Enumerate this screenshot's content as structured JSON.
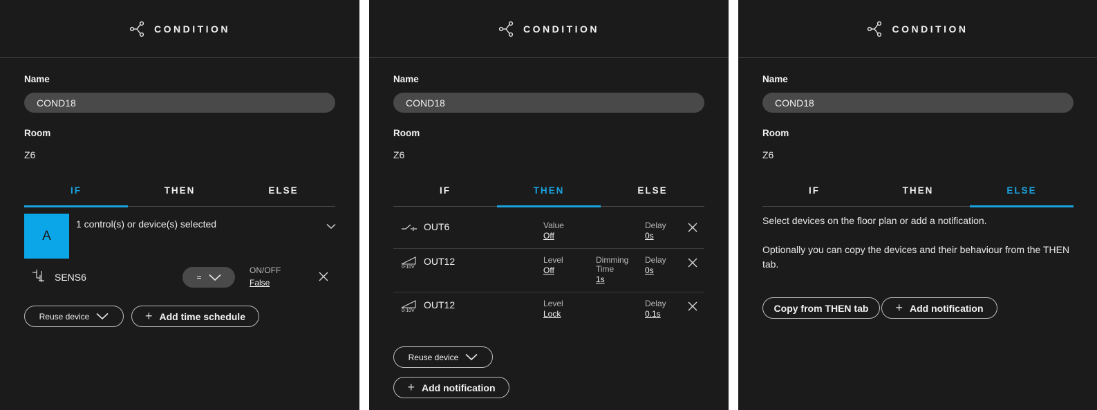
{
  "header": {
    "title": "CONDITION",
    "icon": "branch-icon"
  },
  "form": {
    "name_label": "Name",
    "name_value": "COND18",
    "room_label": "Room",
    "room_value": "Z6"
  },
  "tabs": [
    "IF",
    "THEN",
    "ELSE"
  ],
  "if_panel": {
    "active_tab": "IF",
    "group_letter": "A",
    "group_summary": "1 control(s) or device(s) selected",
    "device_name": "SENS6",
    "operator": "=",
    "param_label": "ON/OFF",
    "param_value": "False",
    "reuse_label": "Reuse device",
    "schedule_label": "Add time schedule"
  },
  "then_panel": {
    "active_tab": "THEN",
    "rows": [
      {
        "name": "OUT6",
        "icon": "switch-icon",
        "p1_label": "Value",
        "p1_value": "Off",
        "p2_label": "",
        "p2_value": "",
        "delay_label": "Delay",
        "delay_value": "0s"
      },
      {
        "name": "OUT12",
        "icon": "dimmer-0-10v-icon",
        "p1_label": "Level",
        "p1_value": "Off",
        "p2_label_1": "Dimming",
        "p2_label_2": "Time",
        "p2_value": "1s",
        "delay_label": "Delay",
        "delay_value": "0s"
      },
      {
        "name": "OUT12",
        "icon": "dimmer-0-10v-icon",
        "p1_label": "Level",
        "p1_value": "Lock",
        "delay_label": "Delay",
        "delay_value": "0.1s"
      }
    ],
    "dimmer_caption": "0-10V",
    "reuse_label": "Reuse device",
    "notification_label": "Add notification"
  },
  "else_panel": {
    "active_tab": "ELSE",
    "text1": "Select devices on the floor plan or add a notification.",
    "text2_line1": "Optionally you can copy the devices and their behaviour from the THEN",
    "text2_line2": "tab.",
    "copy_label": "Copy from THEN tab",
    "notification_label": "Add notification"
  },
  "colors": {
    "accent": "#19a3e0",
    "panel_bg": "#1b1b1b",
    "input_bg": "#494949"
  }
}
